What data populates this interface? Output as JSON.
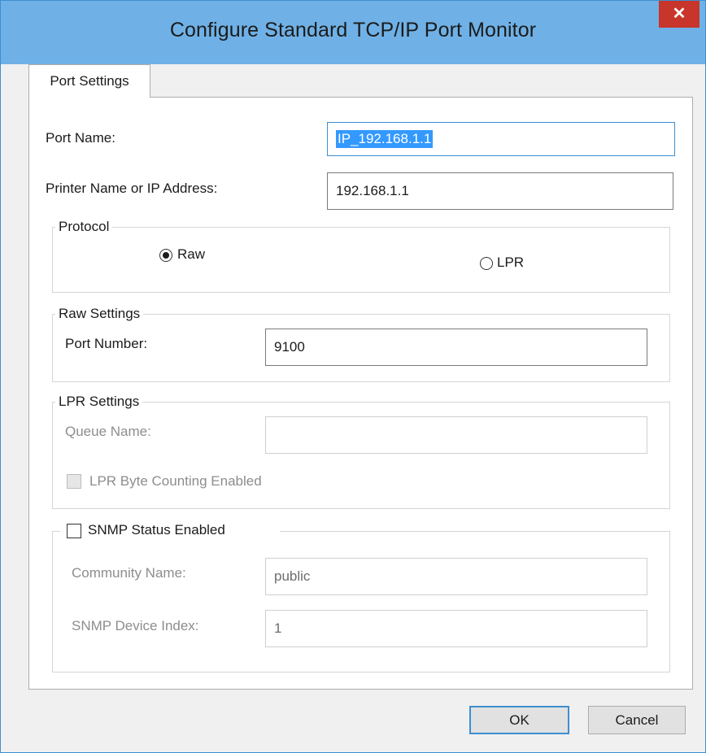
{
  "window": {
    "title": "Configure Standard TCP/IP Port Monitor",
    "close_glyph": "✕"
  },
  "tabs": [
    {
      "label": "Port Settings",
      "active": true
    }
  ],
  "port_name": {
    "label": "Port Name:",
    "value": "IP_192.168.1.1"
  },
  "printer_address": {
    "label": "Printer Name or IP Address:",
    "value": "192.168.1.1"
  },
  "protocol": {
    "legend": "Protocol",
    "options": [
      {
        "label": "Raw",
        "selected": true
      },
      {
        "label": "LPR",
        "selected": false
      }
    ]
  },
  "raw_settings": {
    "legend": "Raw Settings",
    "port_number_label": "Port Number:",
    "port_number_value": "9100"
  },
  "lpr_settings": {
    "legend": "LPR Settings",
    "queue_name_label": "Queue Name:",
    "queue_name_value": "",
    "byte_counting_label": "LPR Byte Counting Enabled",
    "byte_counting_checked": false
  },
  "snmp": {
    "enabled_label": "SNMP Status Enabled",
    "enabled": false,
    "community_label": "Community Name:",
    "community_value": "public",
    "device_index_label": "SNMP Device Index:",
    "device_index_value": "1"
  },
  "buttons": {
    "ok": "OK",
    "cancel": "Cancel"
  },
  "colors": {
    "titlebar": "#6fb1e6",
    "close_button": "#c7352b",
    "selection": "#3399ff",
    "focus_border": "#3c8fd2"
  }
}
